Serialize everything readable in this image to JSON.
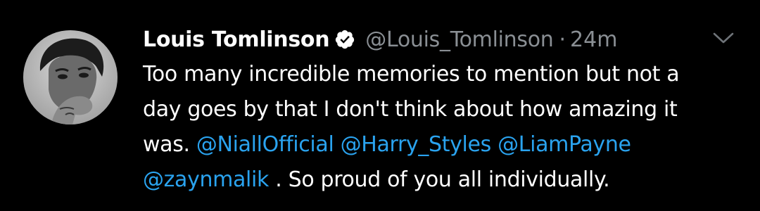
{
  "tweet": {
    "display_name": "Louis Tomlinson",
    "handle": "@Louis_Tomlinson",
    "separator": "·",
    "time": "24m",
    "verified": true,
    "icons": {
      "verified": "verified-badge-icon",
      "menu": "chevron-down-icon",
      "avatar": "profile-photo"
    },
    "text_lines": {
      "line1": "Too many incredible memories to mention but not a",
      "line2": "day goes by that I don't think about how amazing it",
      "line3_prefix": "was. ",
      "line4_suffix": " . So proud of you all individually."
    },
    "mentions": [
      "@NiallOfficial",
      "@Harry_Styles",
      "@LiamPayne",
      "@zaynmalik"
    ]
  },
  "colors": {
    "background": "#000000",
    "text": "#ffffff",
    "secondary": "#8a8f94",
    "link": "#2aa3ef"
  }
}
